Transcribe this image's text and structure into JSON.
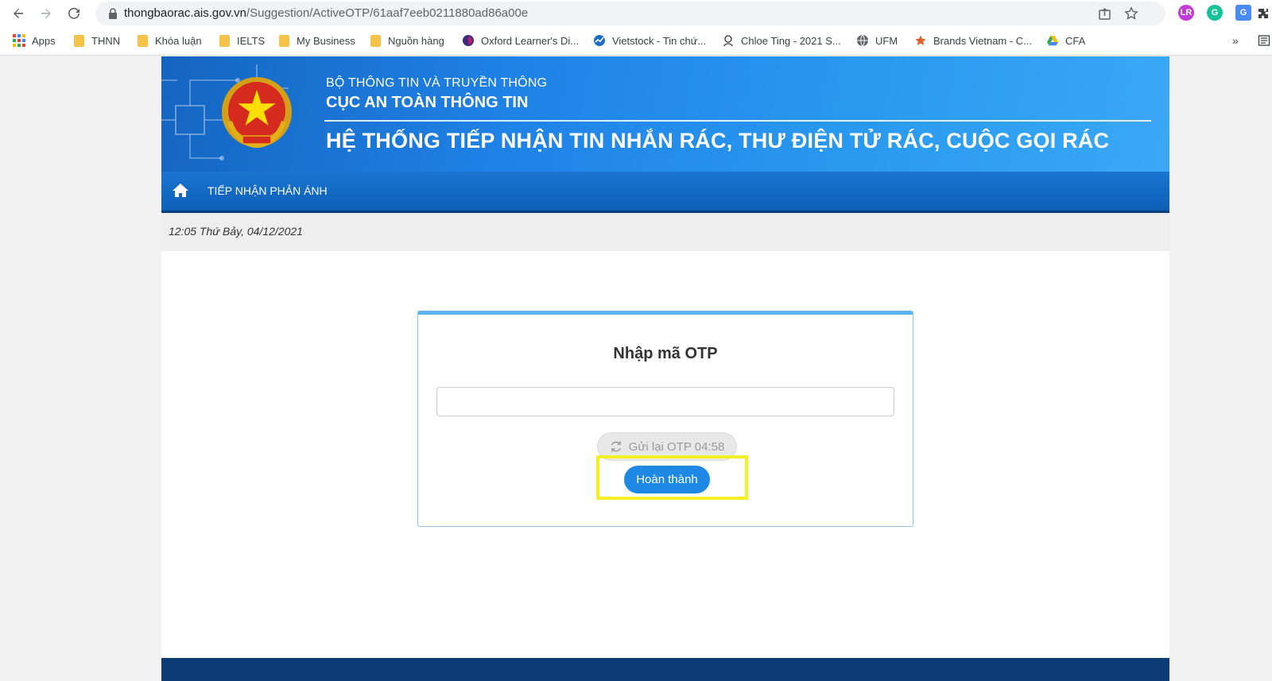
{
  "browser": {
    "url_host": "thongbaorac.ais.gov.vn",
    "url_path": "/Suggestion/ActiveOTP/61aaf7eeb0211880ad86a00e",
    "bookmarks": [
      {
        "label": "Apps",
        "icon": "apps-grid-icon"
      },
      {
        "label": "THNN",
        "icon": "folder-icon"
      },
      {
        "label": "Khóa luận",
        "icon": "folder-icon"
      },
      {
        "label": "IELTS",
        "icon": "folder-icon"
      },
      {
        "label": "My Business",
        "icon": "folder-icon"
      },
      {
        "label": "Nguồn hàng",
        "icon": "folder-icon"
      },
      {
        "label": "Oxford Learner's Di...",
        "icon": "oxford-icon"
      },
      {
        "label": "Vietstock - Tin chứ...",
        "icon": "vietstock-icon"
      },
      {
        "label": "Chloe Ting - 2021 S...",
        "icon": "chloe-icon"
      },
      {
        "label": "UFM",
        "icon": "globe-icon"
      },
      {
        "label": "Brands Vietnam - C...",
        "icon": "star-icon"
      },
      {
        "label": "CFA",
        "icon": "drive-icon"
      }
    ],
    "more_bookmarks": "»"
  },
  "header": {
    "ministry": "BỘ THÔNG TIN VÀ TRUYỀN THÔNG",
    "department": "CỤC AN TOÀN THÔNG TIN",
    "system_title": "HỆ THỐNG TIẾP NHẬN TIN NHẮN RÁC, THƯ ĐIỆN TỬ RÁC, CUỘC GỌI RÁC"
  },
  "menu": {
    "item": "TIẾP NHẬN PHẢN ÁNH"
  },
  "datebar": {
    "datetime": "12:05 Thứ Bảy, 04/12/2021"
  },
  "otp": {
    "title": "Nhập mã OTP",
    "input_value": "",
    "resend_label": "Gửi lại OTP 04:58",
    "submit_label": "Hoàn thành"
  },
  "colors": {
    "banner_blue": "#1f82e6",
    "button_blue": "#1e88e5",
    "highlight_yellow": "#f5ef24",
    "footer_navy": "#0d3c75"
  }
}
